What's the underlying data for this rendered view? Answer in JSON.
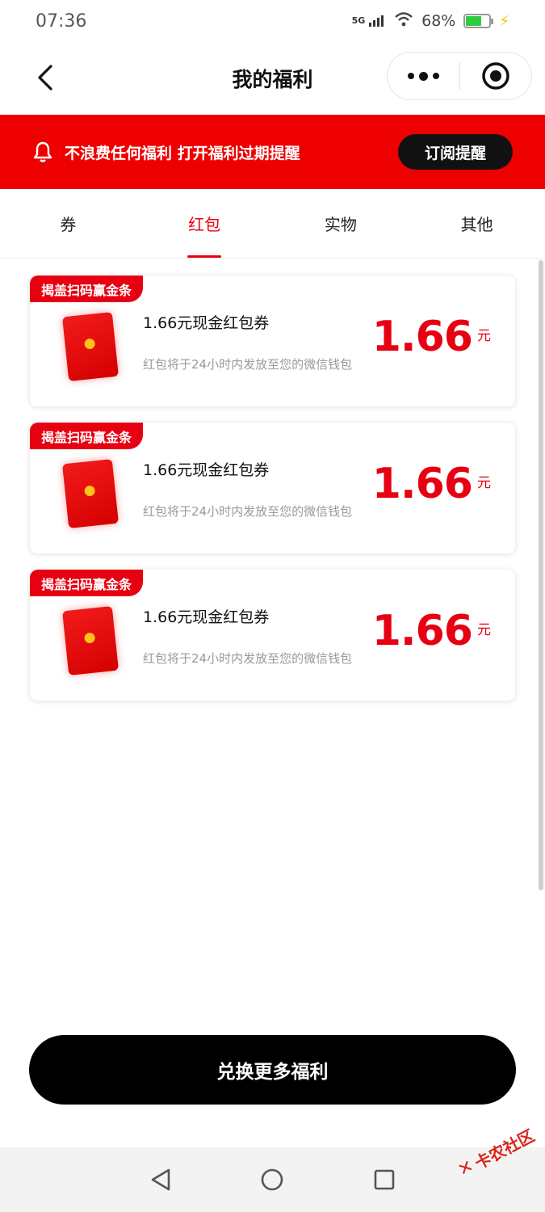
{
  "status_bar": {
    "time": "07:36",
    "network": "5G",
    "battery": "68%"
  },
  "nav": {
    "title": "我的福利"
  },
  "banner": {
    "text": "不浪费任何福利 打开福利过期提醒",
    "button": "订阅提醒"
  },
  "tabs": [
    {
      "label": "券"
    },
    {
      "label": "红包"
    },
    {
      "label": "实物"
    },
    {
      "label": "其他"
    }
  ],
  "active_tab": "红包",
  "cards": [
    {
      "tag": "揭盖扫码赢金条",
      "title": "1.66元现金红包券",
      "desc": "红包将于24小时内发放至您的微信钱包",
      "amount": "1.66",
      "unit": "元"
    },
    {
      "tag": "揭盖扫码赢金条",
      "title": "1.66元现金红包券",
      "desc": "红包将于24小时内发放至您的微信钱包",
      "amount": "1.66",
      "unit": "元"
    },
    {
      "tag": "揭盖扫码赢金条",
      "title": "1.66元现金红包券",
      "desc": "红包将于24小时内发放至您的微信钱包",
      "amount": "1.66",
      "unit": "元"
    }
  ],
  "exchange_button": "兑换更多福利",
  "watermark": "卡农社区",
  "colors": {
    "brand_red": "#e60012",
    "banner_red": "#ee0000",
    "button_black": "#000000"
  },
  "icons": {
    "back": "chevron-left-icon",
    "more": "more-dots-icon",
    "close": "target-circle-icon",
    "bell": "bell-icon",
    "envelope": "red-envelope-icon"
  }
}
